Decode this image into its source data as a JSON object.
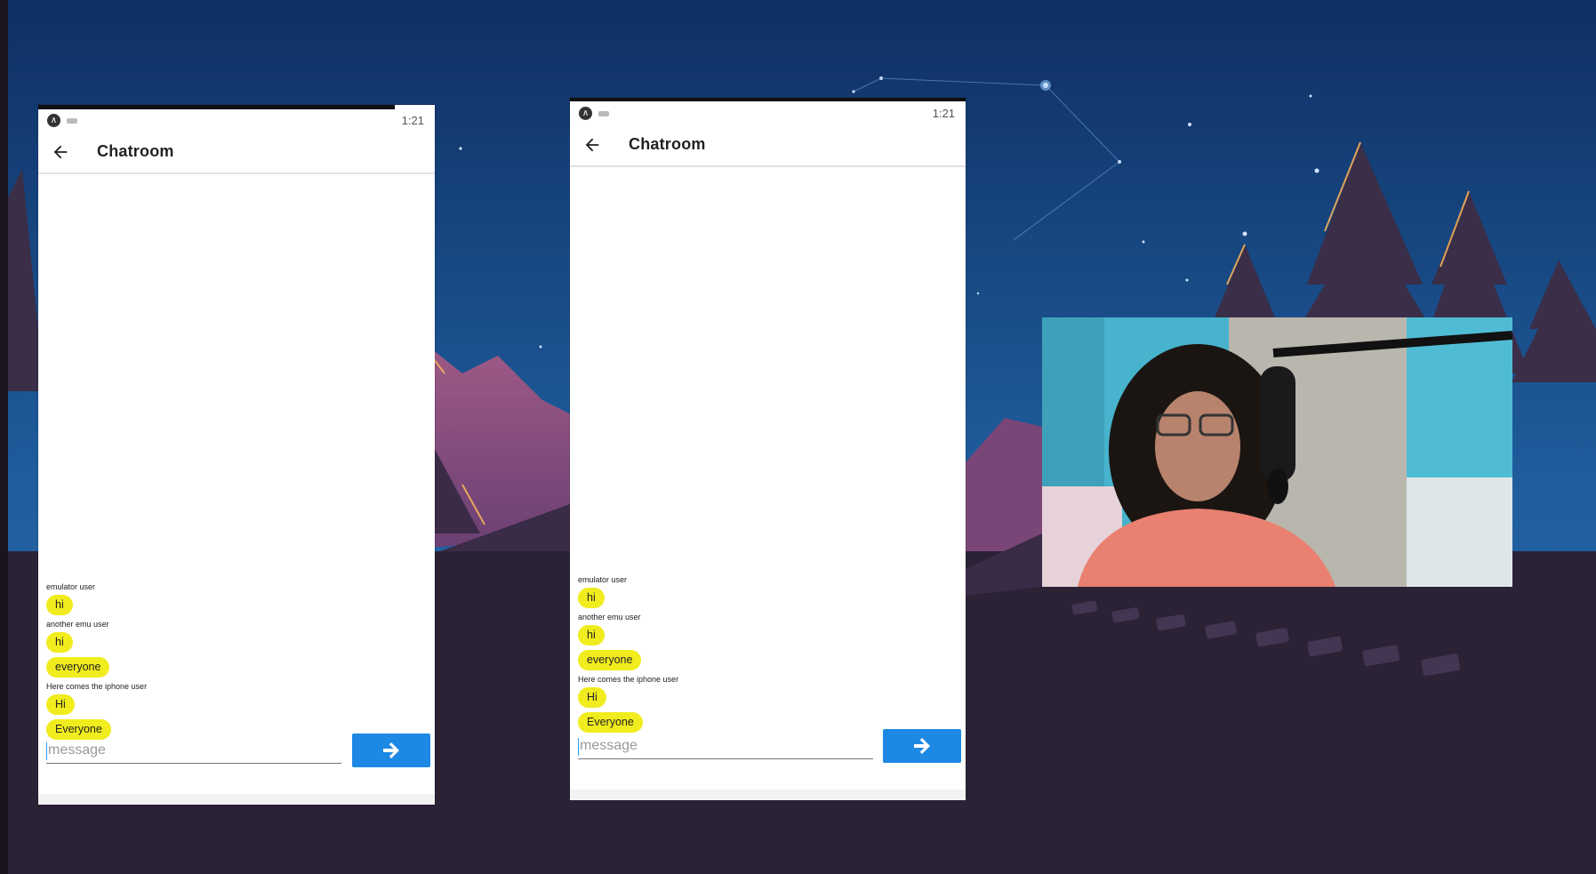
{
  "colors": {
    "sky_top": "#123a73",
    "sky_bottom": "#1e5c9c",
    "ground": "#2b2236",
    "bubble": "#f1ec1d",
    "send_button": "#1e88e5",
    "webcam_wall": "#4db6cf"
  },
  "phones": {
    "left": {
      "status_time": "1:21",
      "title": "Chatroom",
      "messages": [
        {
          "sender": "emulator user",
          "bubbles": [
            "hi"
          ]
        },
        {
          "sender": "another emu user",
          "bubbles": [
            "hi",
            "everyone"
          ]
        },
        {
          "sender": "Here comes the iphone user",
          "bubbles": [
            "Hi",
            "Everyone"
          ]
        }
      ],
      "input_placeholder": "message",
      "send_icon": "arrow-right-icon"
    },
    "right": {
      "status_time": "1:21",
      "title": "Chatroom",
      "messages": [
        {
          "sender": "emulator user",
          "bubbles": [
            "hi"
          ]
        },
        {
          "sender": "another emu user",
          "bubbles": [
            "hi",
            "everyone"
          ]
        },
        {
          "sender": "Here comes the iphone user",
          "bubbles": [
            "Hi",
            "Everyone"
          ]
        }
      ],
      "input_placeholder": "message",
      "send_icon": "arrow-right-icon"
    }
  },
  "webcam": {
    "icon": "webcam-video-feed"
  }
}
